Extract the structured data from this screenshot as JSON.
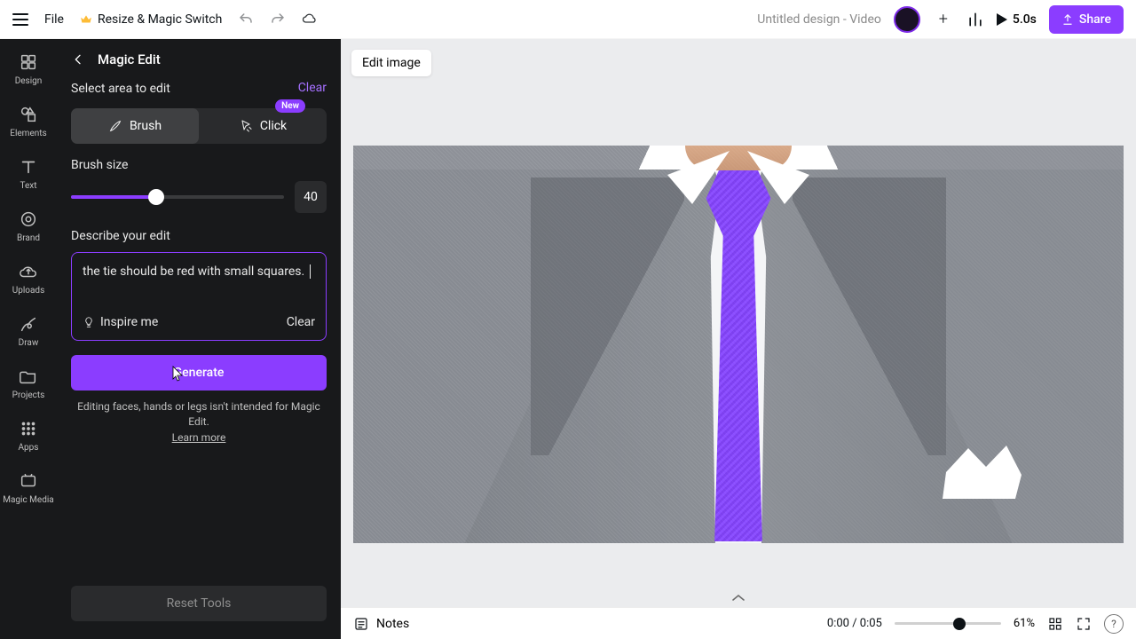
{
  "topbar": {
    "file": "File",
    "resize": "Resize & Magic Switch",
    "docTitle": "Untitled design - Video",
    "duration": "5.0s",
    "share": "Share"
  },
  "rail": {
    "items": [
      {
        "label": "Design"
      },
      {
        "label": "Elements"
      },
      {
        "label": "Text"
      },
      {
        "label": "Brand"
      },
      {
        "label": "Uploads"
      },
      {
        "label": "Draw"
      },
      {
        "label": "Projects"
      },
      {
        "label": "Apps"
      },
      {
        "label": "Magic Media"
      }
    ]
  },
  "panel": {
    "title": "Magic Edit",
    "selectArea": "Select area to edit",
    "clear": "Clear",
    "newBadge": "New",
    "brush": "Brush",
    "click": "Click",
    "brushSize": "Brush size",
    "sizeVal": "40",
    "describe": "Describe your edit",
    "prompt": "the tie should be red with small squares. ",
    "inspire": "Inspire me",
    "clear2": "Clear",
    "generate": "Generate",
    "disclaimer": "Editing faces, hands or legs isn't intended for Magic Edit.",
    "learn": "Learn more",
    "reset": "Reset Tools"
  },
  "canvas": {
    "editImage": "Edit image"
  },
  "bottombar": {
    "notes": "Notes",
    "time": "0:00 / 0:05",
    "zoom": "61%"
  }
}
